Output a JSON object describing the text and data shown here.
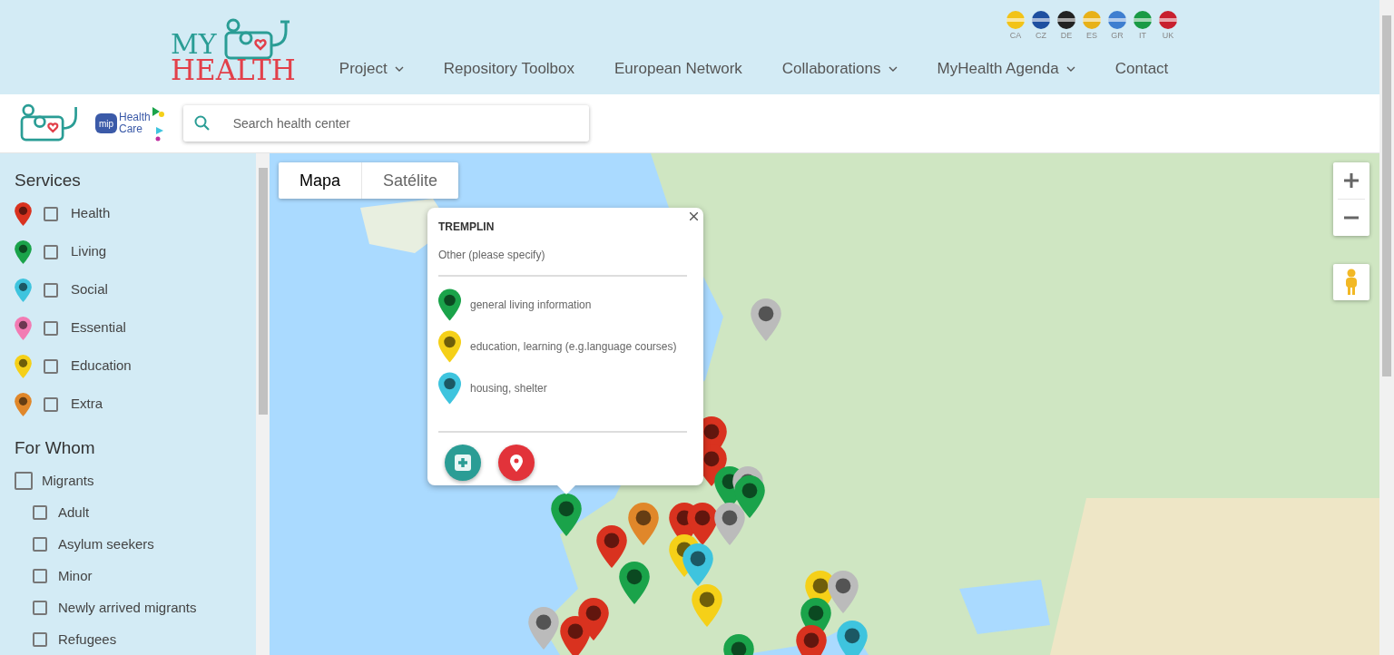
{
  "header": {
    "logo": {
      "line_1": "MY",
      "line_2": "HEALTH"
    },
    "nav": [
      {
        "label": "Project",
        "dropdown": true
      },
      {
        "label": "Repository Toolbox",
        "dropdown": false
      },
      {
        "label": "European Network",
        "dropdown": false
      },
      {
        "label": "Collaborations",
        "dropdown": true
      },
      {
        "label": "MyHealth Agenda",
        "dropdown": true
      },
      {
        "label": "Contact",
        "dropdown": false
      }
    ],
    "languages": [
      {
        "code": "CA",
        "color": "#f2c318"
      },
      {
        "code": "CZ",
        "color": "#1e4fa0"
      },
      {
        "code": "DE",
        "color": "#222222"
      },
      {
        "code": "ES",
        "color": "#e8b118"
      },
      {
        "code": "GR",
        "color": "#3f7fd0"
      },
      {
        "code": "IT",
        "color": "#1a9a45"
      },
      {
        "code": "UK",
        "color": "#c8202f"
      }
    ]
  },
  "toolbar": {
    "badge": {
      "line_1": "Health",
      "line_2": "Care",
      "mark": "mip"
    },
    "search": {
      "placeholder": "Search health center"
    }
  },
  "sidebar": {
    "services_title": "Services",
    "services": [
      {
        "label": "Health",
        "color": "#d9321f",
        "checked": false
      },
      {
        "label": "Living",
        "color": "#1aa34a",
        "checked": false
      },
      {
        "label": "Social",
        "color": "#3ec4de",
        "checked": false
      },
      {
        "label": "Essential",
        "color": "#f27bb3",
        "checked": false
      },
      {
        "label": "Education",
        "color": "#f5d018",
        "checked": false
      },
      {
        "label": "Extra",
        "color": "#e0872a",
        "checked": false
      }
    ],
    "for_whom_title": "For Whom",
    "for_whom": [
      {
        "label": "Migrants",
        "checked": false,
        "children": [
          {
            "label": "Adult",
            "checked": false
          },
          {
            "label": "Asylum seekers",
            "checked": false
          },
          {
            "label": "Minor",
            "checked": false
          },
          {
            "label": "Newly arrived migrants",
            "checked": false
          },
          {
            "label": "Refugees",
            "checked": false
          }
        ]
      }
    ]
  },
  "map": {
    "map_types": [
      {
        "label": "Mapa",
        "selected": true
      },
      {
        "label": "Satélite",
        "selected": false
      }
    ],
    "popup": {
      "title": "TREMPLIN",
      "subtitle": "Other (please specify)",
      "services": [
        {
          "label": "general living information",
          "color": "#1aa34a"
        },
        {
          "label": "education, learning (e.g.language courses)",
          "color": "#f5d018"
        },
        {
          "label": "housing, shelter",
          "color": "#3ec4de"
        }
      ]
    }
  }
}
